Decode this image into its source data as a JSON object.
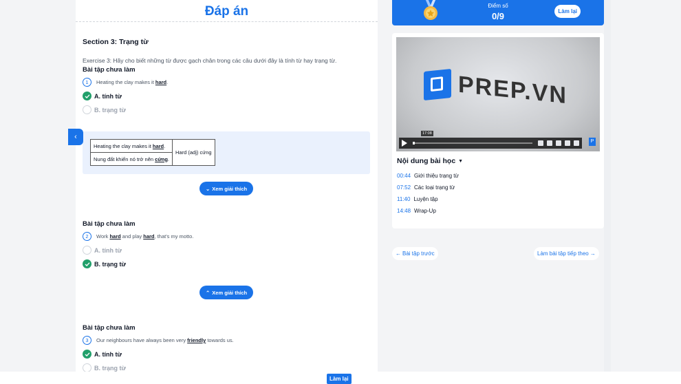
{
  "answer_panel": {
    "title": "Đáp án",
    "section_title": "Section 3: Trạng từ",
    "instruction": "Exercise 3: Hãy cho biết những từ được gạch chân trong các câu dưới đây là tính từ hay trạng từ.",
    "questions": [
      {
        "status": "Bài tập chưa làm",
        "number": "1",
        "text_before": "Heating the clay makes it ",
        "underlined": "hard",
        "text_after": ".",
        "options": [
          {
            "label": "A. tính từ",
            "correct": true
          },
          {
            "label": "B. trạng từ",
            "correct": false
          }
        ]
      },
      {
        "status": "Bài tập chưa làm",
        "number": "2",
        "text_part1": "Work ",
        "underlined1": "hard",
        "text_part2": " and play ",
        "underlined2": "hard",
        "text_part3": ", that's my motto.",
        "options": [
          {
            "label": "A. tính từ",
            "correct": false
          },
          {
            "label": "B. trạng từ",
            "correct": true
          }
        ]
      },
      {
        "status": "Bài tập chưa làm",
        "number": "3",
        "text_before": "Our neighbours have always been very ",
        "underlined": "friendly",
        "text_after": " towards us.",
        "options": [
          {
            "label": "A. tính từ",
            "correct": true
          },
          {
            "label": "B. trạng từ",
            "correct": false
          }
        ]
      }
    ],
    "explanation_table": {
      "row1_before": "Heating the clay makes it ",
      "row1_under": "hard",
      "row1_after": ".",
      "row2_before": "Nung đất khiến nó trở nên ",
      "row2_under": "cứng",
      "row2_after": ".",
      "right_cell": "Hard (adj) cứng"
    },
    "explain_button_label": "Xem giải thích"
  },
  "score": {
    "label": "Điểm số",
    "value": "0/9",
    "retry_label": "Làm lại"
  },
  "video": {
    "brand": "PREP.VN",
    "time_tooltip": "17:08"
  },
  "lesson": {
    "title": "Nội dung bài học",
    "items": [
      {
        "time": "00:44",
        "label": "Giới thiệu trạng từ"
      },
      {
        "time": "07:52",
        "label": "Các loại trạng từ"
      },
      {
        "time": "11:40",
        "label": "Luyện tập"
      },
      {
        "time": "14:48",
        "label": "Wrap-Up"
      }
    ]
  },
  "navigation": {
    "prev_label": "Bài tập trước",
    "next_label": "Làm bài tập tiếp theo"
  },
  "bottom": {
    "retry_label": "Làm lại"
  },
  "colors": {
    "accent": "#1a73e8",
    "correct": "#22a06b"
  }
}
